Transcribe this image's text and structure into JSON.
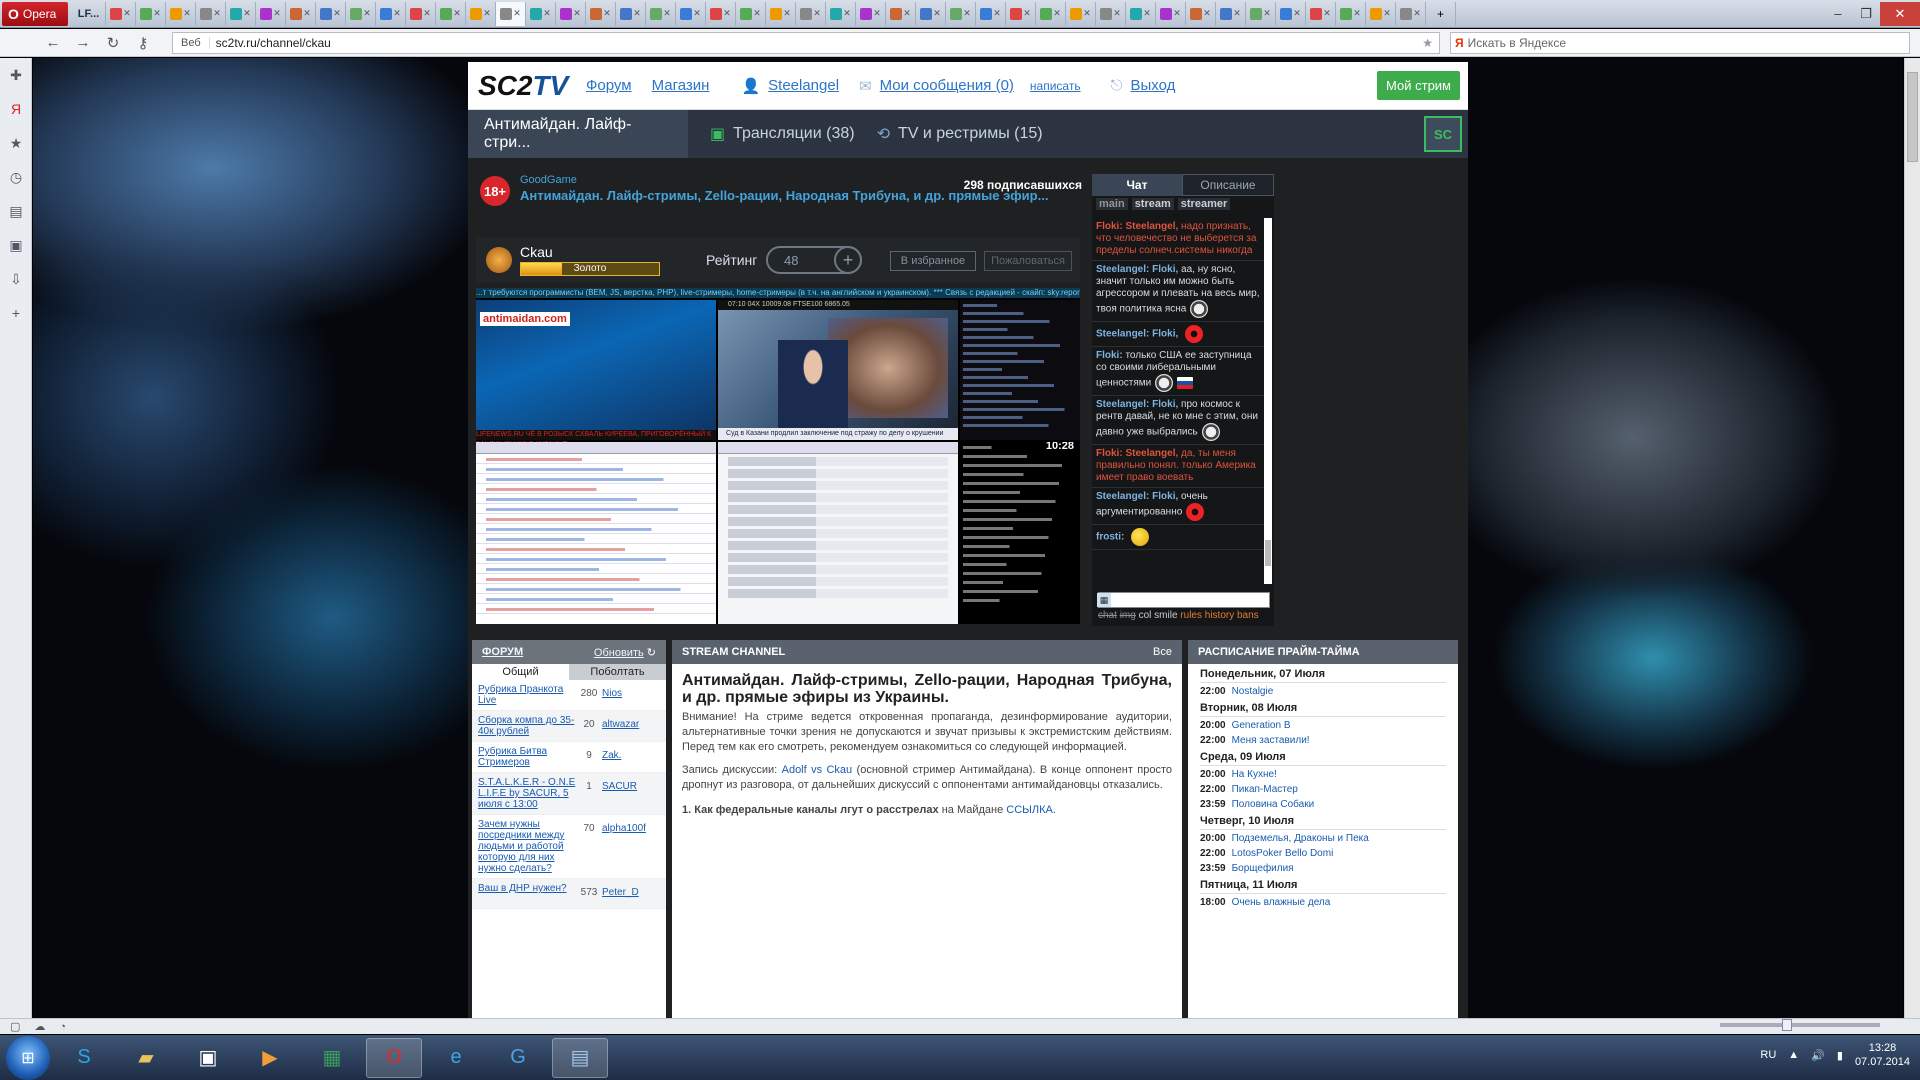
{
  "browser": {
    "menu_label": "Opera",
    "first_tab_label": "LF...",
    "tab_count": 45,
    "address": "sc2tv.ru/channel/ckau",
    "address_badge": "Веб",
    "search_placeholder": "Искать в Яндексе",
    "window_controls": [
      "–",
      "❐",
      "✕"
    ]
  },
  "site": {
    "logo_sc": "SC2",
    "logo_tv": "TV",
    "header_links": {
      "forum": "Форум",
      "shop": "Магазин",
      "user": "Steelangel",
      "messages": "Мои сообщения (0)",
      "write": "написать",
      "logout": "Выход"
    },
    "my_stream_button": "Мой стрим",
    "nav": {
      "active": "Антимайдан. Лайф-стри...",
      "broadcasts": "Трансляции (38)",
      "tv": "TV и рестримы (15)"
    },
    "channel": {
      "age_badge": "18+",
      "source": "GoodGame",
      "title": "Антимайдан. Лайф-стримы, Zello-рации, Народная Трибуна, и др. прямые эфир...",
      "subscribers": "298 подписавшихся",
      "streamer": "Ckau",
      "rank_label": "Золото",
      "rank_progress": 0.3,
      "rating_label": "Рейтинг",
      "rating_value": "48",
      "favorite_button": "В избранное",
      "complain_button": "Пожаловаться"
    },
    "video": {
      "ticker": "...т требуются программисты (BEM, JS, верстка, PHP), live-стримеры, home-стримеры (в т.ч. на английском и украинском). *** Связь с редакцией - скайп: sky.report...",
      "clock": "10:28",
      "panel1_logo": "antimaidan.com",
      "panel2_caption": "Суд в Казани продлил заключение под стражу по делу о крушении «Булгарии»",
      "panel2_top": "07:10  04X  10009.08  FTSE100  6865.05",
      "panel1_bar": "LIFENEWS.RU  ЧЁ В РОЗЫСК СХВАЛЬ КИРЕЕВА, ПРИГОВОРЁННЫЙ К ЗАКЛЮЧЕНИЮ В УКРАИНЕ"
    }
  },
  "chat": {
    "tab_chat": "Чат",
    "tab_desc": "Описание",
    "rooms": [
      "main",
      "stream",
      "streamer"
    ],
    "messages": [
      {
        "author": "Floki:",
        "to": "Steelangel,",
        "text": "надо признать, что человечество не выберется за пределы солнеч.системы никогда",
        "red": true
      },
      {
        "author": "Steelangel:",
        "to": "Floki,",
        "text": "аа, ну ясно, значит только им можно быть агрессором и плевать на весь мир, твоя политика ясна",
        "red": false,
        "smile": "face"
      },
      {
        "author": "Steelangel:",
        "to": "Floki,",
        "text": "",
        "red": false,
        "smile": "angry"
      },
      {
        "author": "Floki:",
        "to": "",
        "text": "только США ее заступница со своими либеральными ценностями",
        "red": false,
        "smile": "face",
        "flag": true
      },
      {
        "author": "Steelangel:",
        "to": "Floki,",
        "text": "про космос к рентв давай, не ко мне с этим, они давно уже выбрались",
        "red": false,
        "smile": "face"
      },
      {
        "author": "Floki:",
        "to": "Steelangel,",
        "text": "да, ты меня правильно понял. только Америка имеет право воевать",
        "red": true
      },
      {
        "author": "Steelangel:",
        "to": "Floki,",
        "text": "очень аргументированно",
        "red": false,
        "smile": "angry"
      },
      {
        "author": "frosti:",
        "to": "",
        "text": "",
        "red": false,
        "smile": "smile"
      }
    ],
    "toolbar": {
      "chat": "chat",
      "img": "img",
      "col": "col",
      "smile": "smile",
      "rules": "rules",
      "history": "history",
      "bans": "bans"
    }
  },
  "forum": {
    "title": "ФОРУМ",
    "refresh": "Обновить",
    "tab_general": "Общий",
    "tab_chatter": "Поболтать",
    "threads": [
      {
        "title": "Рубрика Пранкота Live",
        "count": "280",
        "user": "Nios"
      },
      {
        "title": "Сборка компа до 35-40к рублей",
        "count": "20",
        "user": "altwazar"
      },
      {
        "title": "Рубрика Битва Стримеров",
        "count": "9",
        "user": "Zak."
      },
      {
        "title": "S.T.A.L.K.E.R - O.N.E L.I.F.E by SACUR, 5 июля с 13:00",
        "count": "1",
        "user": "SACUR"
      },
      {
        "title": "Зачем нужны посредники между людьми и работой которую для них нужно сделать?",
        "count": "70",
        "user": "alpha100f"
      },
      {
        "title": "Ваш в ДНР нужен?",
        "count": "573",
        "user": "Peter_D"
      }
    ]
  },
  "stream_channel": {
    "title": "STREAM CHANNEL",
    "all": "Все",
    "headline": "Антимайдан. Лайф-стримы, Zello-рации, Народная Трибуна, и др. прямые эфиры из Украины.",
    "p1": "Внимание! На стриме ведется откровенная пропаганда, дезинформирование аудитории, альтернативные точки зрения не допускаются и звучат призывы к экстремистским действиям. Перед тем как его смотреть, рекомендуем ознакомиться со следующей информацией.",
    "p2_pre": "Запись дискуссии: ",
    "p2_link": "Adolf vs Ckau",
    "p2_post": " (основной стример Антимайдана). В конце оппонент просто дропнут из разговора, от дальнейших дискуссий с оппонентами антимайдановцы отказались.",
    "p3_bold": "1. Как федеральные каналы лгут о расстрелах",
    "p3_mid": " на Майдане ",
    "p3_link": "ССЫЛКА",
    "p3_end": "."
  },
  "schedule": {
    "title": "РАСПИСАНИЕ ПРАЙМ-ТАЙМА",
    "days": [
      {
        "day": "Понедельник, 07 Июля",
        "items": [
          {
            "time": "22:00",
            "name": "Nostalgie"
          }
        ]
      },
      {
        "day": "Вторник, 08 Июля",
        "items": [
          {
            "time": "20:00",
            "name": "Generation B"
          },
          {
            "time": "22:00",
            "name": "Меня заставили!"
          }
        ]
      },
      {
        "day": "Среда, 09 Июля",
        "items": [
          {
            "time": "20:00",
            "name": "На Кухне!"
          },
          {
            "time": "22:00",
            "name": "Пикап-Мастер"
          },
          {
            "time": "23:59",
            "name": "Половина Собаки"
          }
        ]
      },
      {
        "day": "Четверг, 10 Июля",
        "items": [
          {
            "time": "20:00",
            "name": "Подземелья, Драконы и Пека"
          },
          {
            "time": "22:00",
            "name": "LotosPoker Bello Domi"
          },
          {
            "time": "23:59",
            "name": "Борщефилия"
          }
        ]
      },
      {
        "day": "Пятница, 11 Июля",
        "items": [
          {
            "time": "18:00",
            "name": "Очень влажные дела"
          }
        ]
      }
    ]
  },
  "taskbar": {
    "lang": "RU",
    "time": "13:28",
    "date": "07.07.2014"
  },
  "colors": {
    "accent_green": "#3eac4d",
    "link_blue": "#2e74c6",
    "chat_red": "#e0533c"
  }
}
